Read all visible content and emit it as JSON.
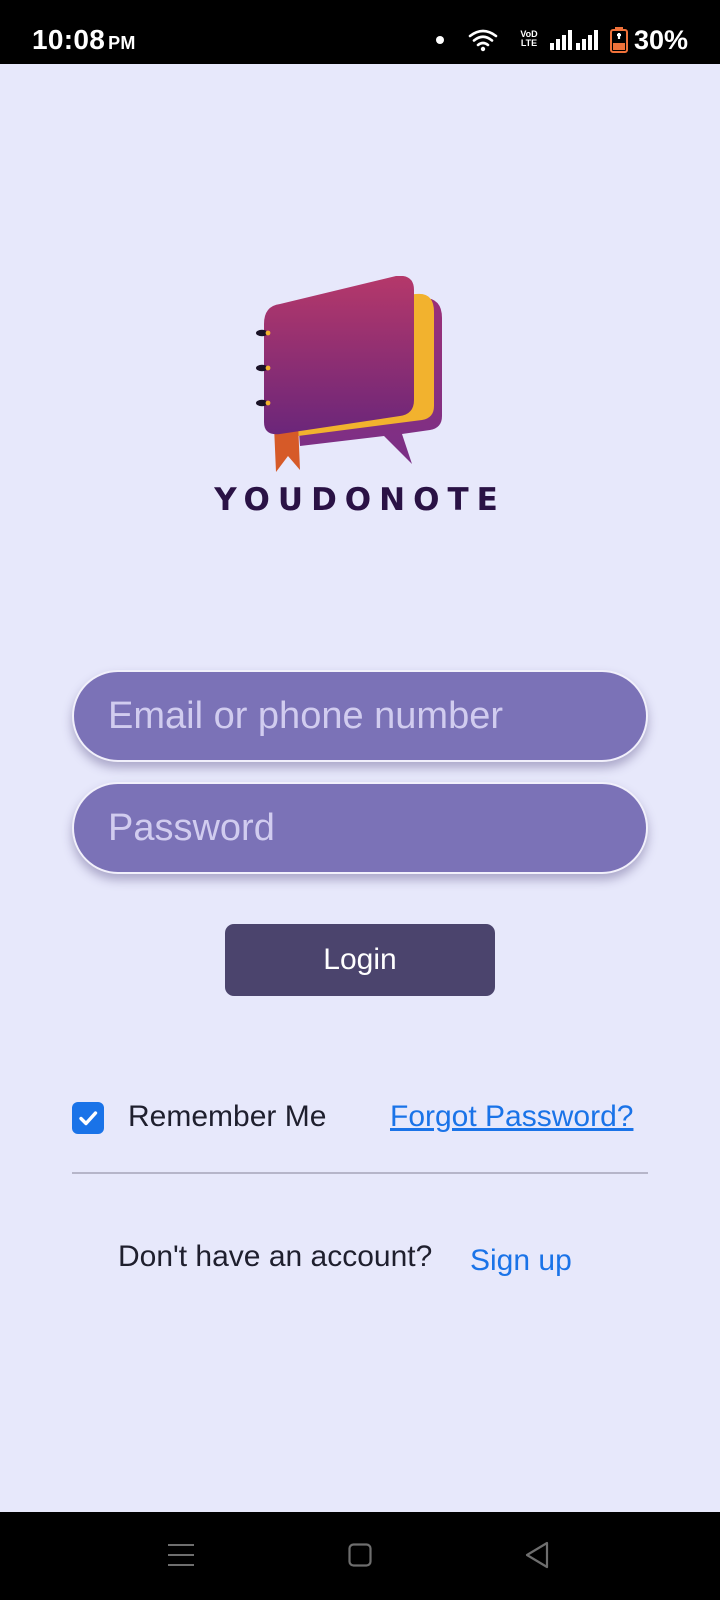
{
  "status_bar": {
    "time": "10:08",
    "ampm": "PM",
    "network_label": "VoD LTE",
    "battery_percent": "30%",
    "icons": [
      "notification-dot-icon",
      "wifi-icon",
      "volte-icon",
      "signal-icon",
      "signal-icon",
      "battery-charging-icon"
    ]
  },
  "brand": {
    "name": "YOUDONOTE",
    "logo_icon": "notebook-chat-bubble-logo",
    "colors": {
      "bubble_top": "#b23a6a",
      "bubble_bottom": "#6a2a7c",
      "back_bubble": "#8a3586",
      "back_accent": "#f2b22e",
      "bookmark": "#d65a28",
      "text": "#2a1245"
    }
  },
  "login_form": {
    "email_placeholder": "Email or phone number",
    "password_placeholder": "Password",
    "login_label": "Login",
    "remember_label": "Remember Me",
    "remember_checked": true,
    "forgot_label": "Forgot Password?"
  },
  "signup": {
    "prompt": "Don't have an account?",
    "link_label": "Sign up"
  },
  "nav_bar": {
    "icons": [
      "menu-icon",
      "home-icon",
      "back-icon"
    ]
  },
  "colors": {
    "background": "#e7e8fb",
    "field_fill": "#7b72b7",
    "button_fill": "#4b446d",
    "link": "#1a73e8"
  }
}
